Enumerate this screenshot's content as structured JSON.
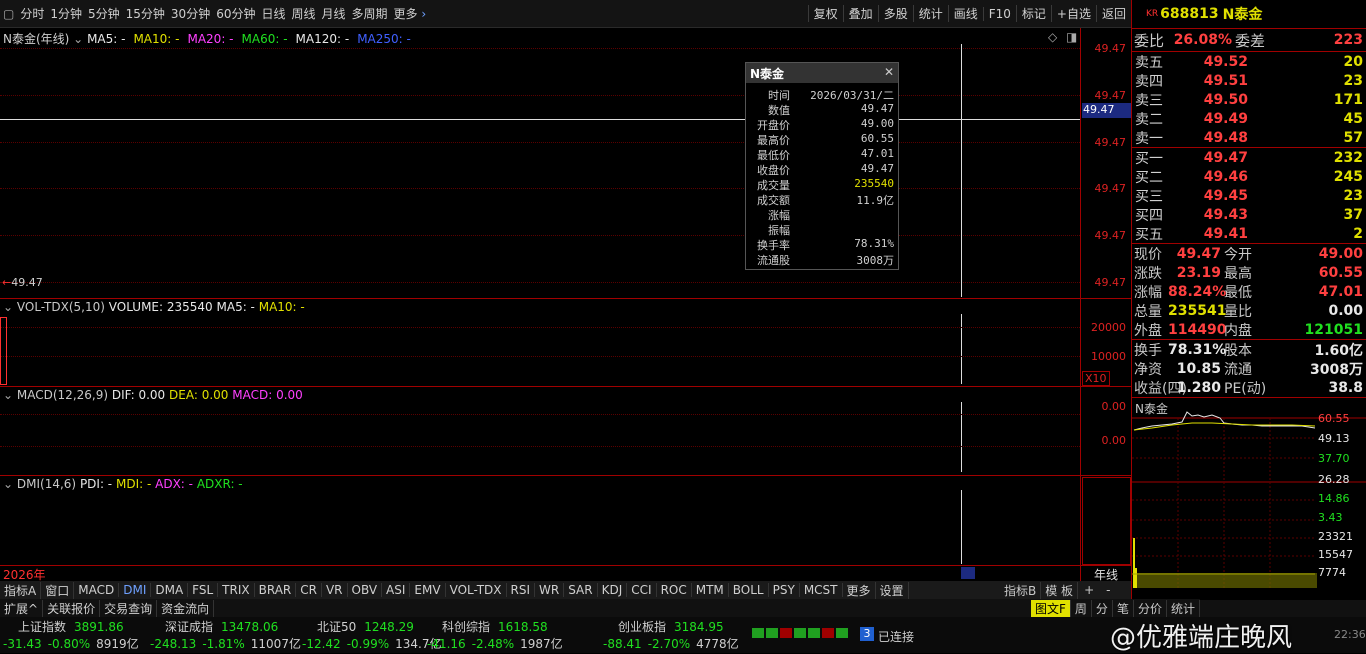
{
  "toolbar": {
    "periods": [
      "分时",
      "1分钟",
      "5分钟",
      "15分钟",
      "30分钟",
      "60分钟",
      "日线",
      "周线",
      "月线",
      "多周期"
    ],
    "more": "更多",
    "right_buttons": [
      "复权",
      "叠加",
      "多股",
      "统计",
      "画线",
      "F10",
      "标记",
      "+自选",
      "返回"
    ]
  },
  "main_chart": {
    "legend_name": "N泰金(年线)",
    "ma": [
      {
        "label": "MA5: -",
        "color": "#e8e8e8"
      },
      {
        "label": "MA10: -",
        "color": "#e0e000"
      },
      {
        "label": "MA20: -",
        "color": "#ff40ff"
      },
      {
        "label": "MA60: -",
        "color": "#20e020"
      },
      {
        "label": "MA120: -",
        "color": "#e8e8e8"
      },
      {
        "label": "MA250: -",
        "color": "#4060ff"
      }
    ],
    "y_labels": [
      "49.47",
      "49.47",
      "49.47",
      "49.47",
      "49.47",
      "49.47"
    ],
    "cursor_price": "49.47",
    "price_marker": "←49.47"
  },
  "ohlc_popup": {
    "title": "N泰金",
    "rows": [
      {
        "k": "时间",
        "v": "2026/03/31/二",
        "c": "#d0d0d0"
      },
      {
        "k": "数值",
        "v": "49.47",
        "c": "#d0d0d0"
      },
      {
        "k": "开盘价",
        "v": "49.00",
        "c": "#d0d0d0"
      },
      {
        "k": "最高价",
        "v": "60.55",
        "c": "#d0d0d0"
      },
      {
        "k": "最低价",
        "v": "47.01",
        "c": "#d0d0d0"
      },
      {
        "k": "收盘价",
        "v": "49.47",
        "c": "#d0d0d0"
      },
      {
        "k": "成交量",
        "v": "235540",
        "c": "#e0e000"
      },
      {
        "k": "成交额",
        "v": "11.9亿",
        "c": "#d0d0d0"
      },
      {
        "k": "涨幅",
        "v": "",
        "c": "#d0d0d0"
      },
      {
        "k": "振幅",
        "v": "",
        "c": "#d0d0d0"
      },
      {
        "k": "换手率",
        "v": "78.31%",
        "c": "#d0d0d0"
      },
      {
        "k": "流通股",
        "v": "3008万",
        "c": "#d0d0d0"
      }
    ]
  },
  "vol_panel": {
    "legend": "VOL-TDX(5,10)",
    "volume": "VOLUME: 235540",
    "ma5": "MA5: -",
    "ma10": "MA10: -",
    "y_labels": [
      "20000",
      "10000"
    ],
    "unit": "X10"
  },
  "macd_panel": {
    "legend": "MACD(12,26,9)",
    "dif": "DIF: 0.00",
    "dea": "DEA: 0.00",
    "macd": "MACD: 0.00",
    "y_labels": [
      "0.00",
      "0.00"
    ]
  },
  "dmi_panel": {
    "legend": "DMI(14,6)",
    "pdi": "PDI: -",
    "mdi": "MDI: -",
    "adx": "ADX: -",
    "adxr": "ADXR: -"
  },
  "date_axis": {
    "year": "2026年",
    "right_label": "年线"
  },
  "indicator_tabs": [
    "指标A",
    "窗口",
    "MACD",
    "DMI",
    "DMA",
    "FSL",
    "TRIX",
    "BRAR",
    "CR",
    "VR",
    "OBV",
    "ASI",
    "EMV",
    "VOL-TDX",
    "RSI",
    "WR",
    "SAR",
    "KDJ",
    "CCI",
    "ROC",
    "MTM",
    "BOLL",
    "PSY",
    "MCST",
    "更多",
    "设置"
  ],
  "indicator_b": "指标B",
  "template": "模 板",
  "bottom_tabs": [
    "扩展^",
    "关联报价",
    "交易查询",
    "资金流向"
  ],
  "right_panel": {
    "market": "KR",
    "code": "688813",
    "name": "N泰金",
    "weibi_label": "委比",
    "weibi": "26.08%",
    "weicha_label": "委差",
    "weicha": "223",
    "sells": [
      {
        "label": "卖五",
        "price": "49.52",
        "vol": "20"
      },
      {
        "label": "卖四",
        "price": "49.51",
        "vol": "23"
      },
      {
        "label": "卖三",
        "price": "49.50",
        "vol": "171"
      },
      {
        "label": "卖二",
        "price": "49.49",
        "vol": "45"
      },
      {
        "label": "卖一",
        "price": "49.48",
        "vol": "57"
      }
    ],
    "buys": [
      {
        "label": "买一",
        "price": "49.47",
        "vol": "232"
      },
      {
        "label": "买二",
        "price": "49.46",
        "vol": "245"
      },
      {
        "label": "买三",
        "price": "49.45",
        "vol": "23"
      },
      {
        "label": "买四",
        "price": "49.43",
        "vol": "37"
      },
      {
        "label": "买五",
        "price": "49.41",
        "vol": "2"
      }
    ],
    "info": [
      {
        "l1": "现价",
        "v1": "49.47",
        "c1": "red",
        "l2": "今开",
        "v2": "49.00",
        "c2": "red"
      },
      {
        "l1": "涨跌",
        "v1": "23.19",
        "c1": "red",
        "l2": "最高",
        "v2": "60.55",
        "c2": "red"
      },
      {
        "l1": "涨幅",
        "v1": "88.24%",
        "c1": "red",
        "l2": "最低",
        "v2": "47.01",
        "c2": "red"
      },
      {
        "l1": "总量",
        "v1": "235541",
        "c1": "yel",
        "l2": "量比",
        "v2": "0.00",
        "c2": "wht"
      },
      {
        "l1": "外盘",
        "v1": "114490",
        "c1": "red",
        "l2": "内盘",
        "v2": "121051",
        "c2": "grn"
      }
    ],
    "info2": [
      {
        "l1": "换手",
        "v1": "78.31%",
        "c1": "wht",
        "l2": "股本",
        "v2": "1.60亿",
        "c2": "wht"
      },
      {
        "l1": "净资",
        "v1": "10.85",
        "c1": "wht",
        "l2": "流通",
        "v2": "3008万",
        "c2": "wht"
      },
      {
        "l1": "收益(四)",
        "v1": "1.280",
        "c1": "wht",
        "l2": "PE(动)",
        "v2": "38.8",
        "c2": "wht"
      }
    ],
    "mini_title": "N泰金",
    "mini_price_labels": [
      "60.55",
      "49.13",
      "37.70"
    ],
    "mini_pct_labels": [
      "26.28",
      "14.86",
      "3.43"
    ],
    "mini_vol_labels": [
      "23321",
      "15547",
      "7774"
    ],
    "year_tab": "年线",
    "plus": "+",
    "minus": "-",
    "bottom_tabs": [
      "图文F",
      "周",
      "分",
      "笔",
      "分价",
      "统计"
    ]
  },
  "status": {
    "indices": [
      {
        "name": "上证指数",
        "val": "3891.86",
        "chg": "-31.43",
        "pct": "-0.80%",
        "amt": "8919亿"
      },
      {
        "name": "深证成指",
        "val": "13478.06",
        "chg": "-248.13",
        "pct": "-1.81%",
        "amt": "11007亿"
      },
      {
        "name": "北证50",
        "val": "1248.29",
        "chg": "-12.42",
        "pct": "-0.99%",
        "amt": "134.7亿"
      },
      {
        "name": "科创综指",
        "val": "1618.58",
        "chg": "-41.16",
        "pct": "-2.48%",
        "amt": "1987亿"
      },
      {
        "name": "创业板指",
        "val": "3184.95",
        "chg": "-88.41",
        "pct": "-2.70%",
        "amt": "4778亿"
      }
    ],
    "connect_badge": "3",
    "connect_text": "已连接",
    "watermark": "@优雅端庄晚风",
    "time": "22:36"
  }
}
